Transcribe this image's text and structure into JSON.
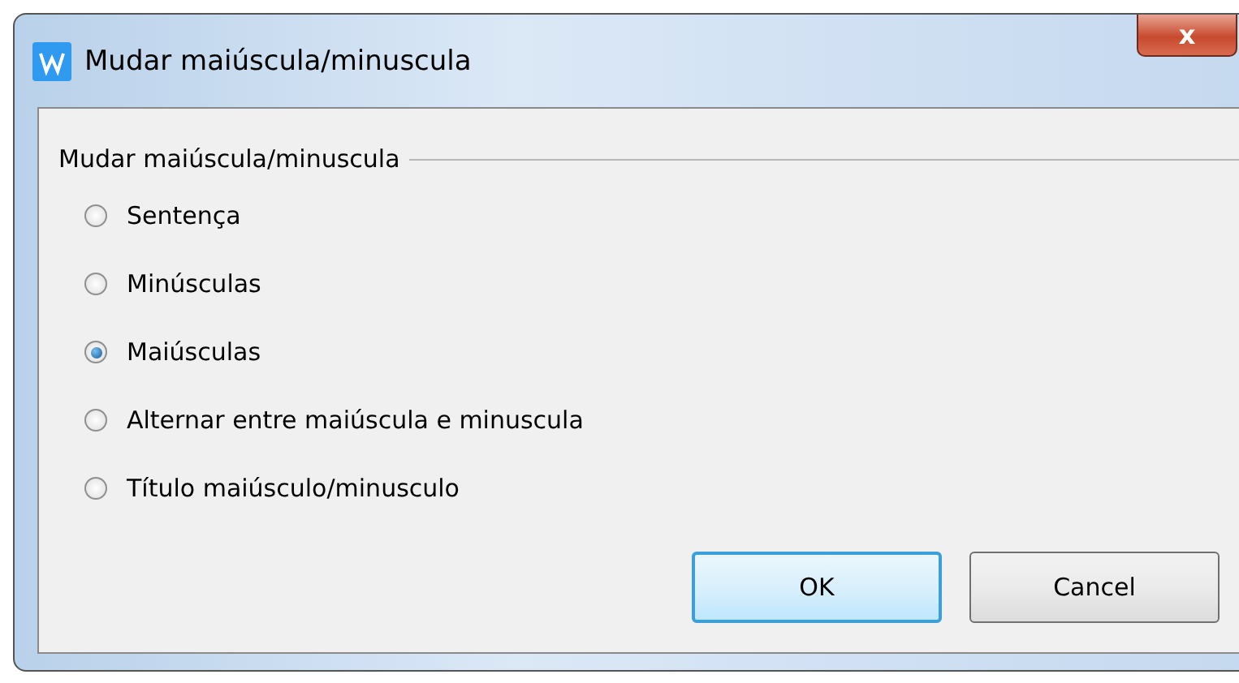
{
  "window": {
    "title": "Mudar maiúscula/minuscula",
    "close": "x"
  },
  "group": {
    "label": "Mudar maiúscula/minuscula"
  },
  "options": [
    {
      "label": "Sentença",
      "selected": false
    },
    {
      "label": "Minúsculas",
      "selected": false
    },
    {
      "label": "Maiúsculas",
      "selected": true
    },
    {
      "label": "Alternar entre maiúscula e minuscula",
      "selected": false
    },
    {
      "label": "Título maiúsculo/minusculo",
      "selected": false
    }
  ],
  "buttons": [
    {
      "label": "OK",
      "kind": "default"
    },
    {
      "label": "Cancel",
      "kind": "normal"
    }
  ]
}
